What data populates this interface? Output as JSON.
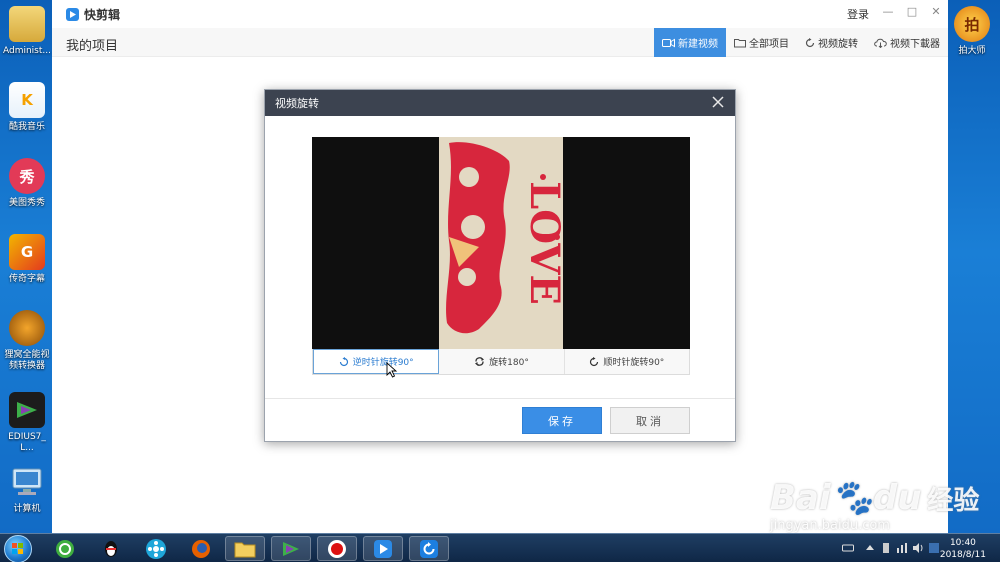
{
  "desktop": {
    "icons": [
      {
        "label": "Administ..."
      },
      {
        "label": "酷我音乐"
      },
      {
        "label": "美图秀秀"
      },
      {
        "label": "传奇字幕"
      },
      {
        "label": "狸窝全能视频转换器"
      },
      {
        "label": "EDIUS7_L..."
      },
      {
        "label": "计算机"
      },
      {
        "label": "拍大师"
      }
    ]
  },
  "app": {
    "name": "快剪辑",
    "login": "登录",
    "page_title": "我的项目",
    "toolbar": {
      "new_video": "新建视频",
      "all_projects": "全部项目",
      "rotate_video": "视频旋转",
      "download_video": "视频下載器"
    }
  },
  "dialog": {
    "title": "视频旋转",
    "rotate_ccw": "逆时针旋转90°",
    "rotate_180": "旋转180°",
    "rotate_cw": "顺时针旋转90°",
    "save": "保存",
    "cancel": "取消",
    "preview_text": "LOVE"
  },
  "taskbar": {
    "time": "10:40",
    "date": "2018/8/11"
  },
  "watermark": {
    "brand": "Bai",
    "brand2": "du",
    "brand_cn": "经验",
    "url": "jingyan.baidu.com"
  }
}
